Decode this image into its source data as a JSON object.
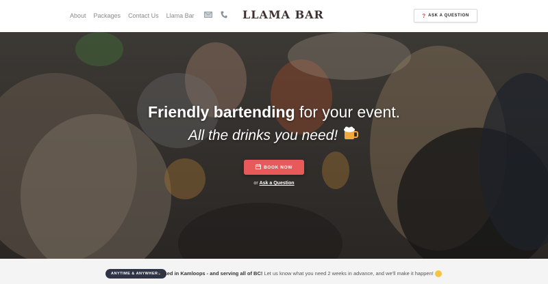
{
  "header": {
    "nav": [
      "About",
      "Packages",
      "Contact Us",
      "Llama Bar"
    ],
    "icons": [
      "mail-icon",
      "phone-icon"
    ],
    "logo": "LLAMA BAR",
    "ask_button": "ASK A QUESTION"
  },
  "hero": {
    "headline_bold": "Friendly bartending",
    "headline_rest": " for your event.",
    "subline": "All the drinks you need!",
    "book_button": "BOOK NOW",
    "or_text": "or ",
    "or_link": "Ask a Question"
  },
  "bottom": {
    "badge": "ANYTIME & ANYWHERE",
    "message_bold": "Based in Kamloops - and serving all of BC!",
    "message_rest": " Let us know what you need 2 weeks in advance, and we'll make it happen!"
  },
  "colors": {
    "accent": "#e85a5a",
    "badge_bg": "#2f3446",
    "logo": "#3d3030"
  }
}
